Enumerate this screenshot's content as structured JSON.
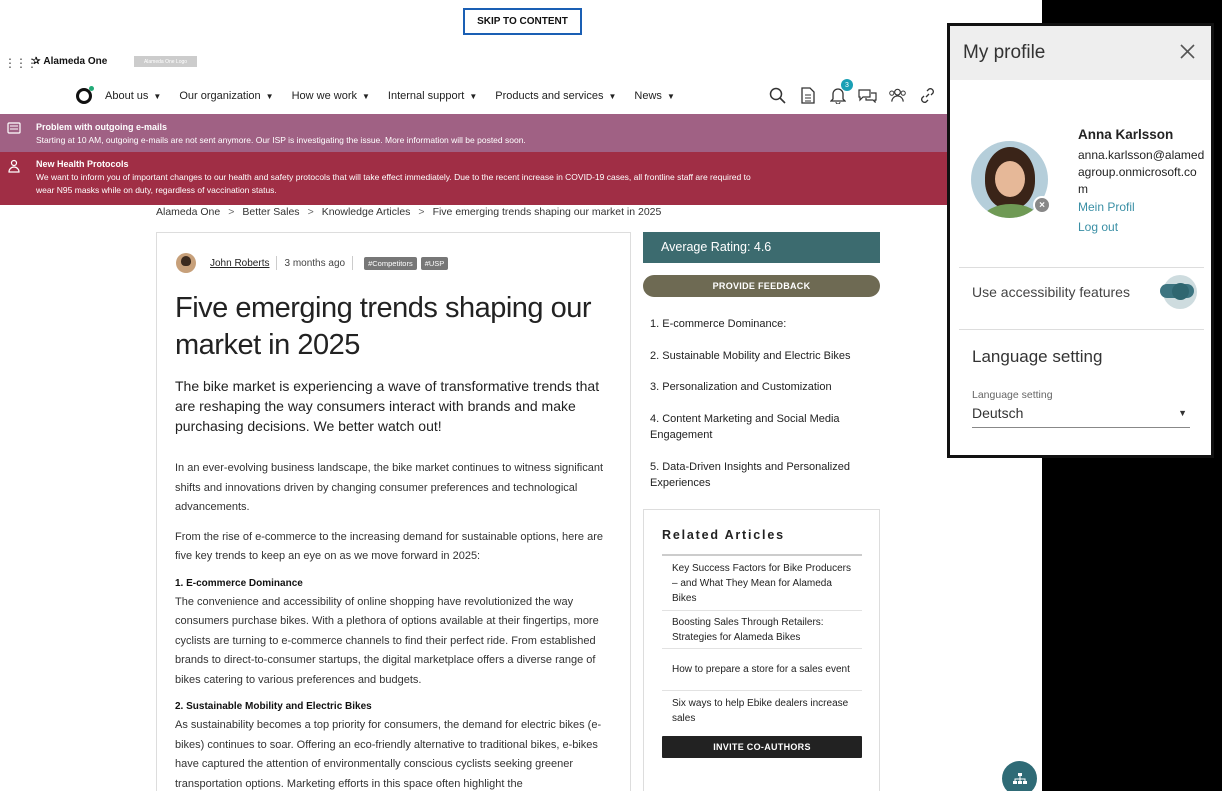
{
  "skip": "SKIP TO CONTENT",
  "header": {
    "apps_glyph": "⋮⋮⋮",
    "brand_name": "Alameda One",
    "logo_placeholder": "Alameda One Logo",
    "nav": [
      "About us",
      "Our organization",
      "How we work",
      "Internal support",
      "Products and services",
      "News"
    ],
    "notification_count": "3"
  },
  "alerts": [
    {
      "title": "Problem with outgoing e-mails",
      "text": "Starting at 10 AM, outgoing e-mails are not sent anymore. Our ISP is investigating the issue. More information will be posted soon."
    },
    {
      "title": "New Health Protocols",
      "text": "We want to inform you of important changes to our health and safety protocols that will take effect immediately. Due to the recent increase in COVID-19 cases, all frontline staff are required to wear N95 masks while on duty, regardless of vaccination status."
    }
  ],
  "breadcrumb": [
    "Alameda One",
    "Better Sales",
    "Knowledge Articles",
    "Five emerging trends shaping our market in 2025"
  ],
  "breadcrumb_sep": ">",
  "article": {
    "author": "John Roberts",
    "time": "3 months ago",
    "tags": [
      "#Competitors",
      "#USP"
    ],
    "title": "Five emerging trends shaping our market in 2025",
    "lead": "The bike market is experiencing a wave of transformative trends that are reshaping the way consumers interact with brands and make purchasing decisions. We better watch out!",
    "p1": "In an ever-evolving business landscape, the bike market continues to witness significant shifts and innovations driven by changing consumer preferences and technological advancements.",
    "p2": "From the rise of e-commerce to the increasing demand for sustainable options, here are five key trends to keep an eye on as we move forward in 2025:",
    "h1": "1. E-commerce Dominance",
    "p3": "The convenience and accessibility of online shopping have revolutionized the way consumers purchase bikes. With a plethora of options available at their fingertips, more cyclists are turning to e-commerce channels to find their perfect ride. From established brands to direct-to-consumer startups, the digital marketplace offers a diverse range of bikes catering to various preferences and budgets.",
    "h2": "2. Sustainable Mobility and Electric Bikes",
    "p4": "As sustainability becomes a top priority for consumers, the demand for electric bikes (e-bikes) continues to soar. Offering an eco-friendly alternative to traditional bikes, e-bikes have captured the attention of environmentally conscious cyclists seeking greener transportation options. Marketing efforts in this space often highlight the"
  },
  "sidebar": {
    "rating": "Average Rating: 4.6",
    "feedback": "PROVIDE FEEDBACK",
    "toc": [
      "1. E-commerce Dominance:",
      "2. Sustainable Mobility and Electric Bikes",
      "3. Personalization and Customization",
      "4. Content Marketing and Social Media Engagement",
      "5. Data-Driven Insights and Personalized Experiences"
    ],
    "related_title": "Related Articles",
    "related": [
      "Key Success Factors for Bike Producers – and What They Mean for Alameda Bikes",
      "Boosting Sales Through Retailers: Strategies for Alameda Bikes",
      "How to prepare a store for a sales event",
      "Six ways to help Ebike dealers increase sales"
    ],
    "invite": "INVITE CO-AUTHORS"
  },
  "profile": {
    "title": "My profile",
    "name": "Anna Karlsson",
    "email": "anna.karlsson@alamedagroup.onmicrosoft.com",
    "link_profile": "Mein Profil",
    "link_logout": "Log out",
    "accessibility_label": "Use accessibility features",
    "accessibility_on": true,
    "language_heading": "Language setting",
    "language_label": "Language setting",
    "language_value": "Deutsch"
  },
  "colors": {
    "rating_bg": "#3c6b6f",
    "feedback_bg": "#6e6a53",
    "alert1": "#a06184",
    "alert2": "#a02e45",
    "accent": "#3a8fa5"
  }
}
